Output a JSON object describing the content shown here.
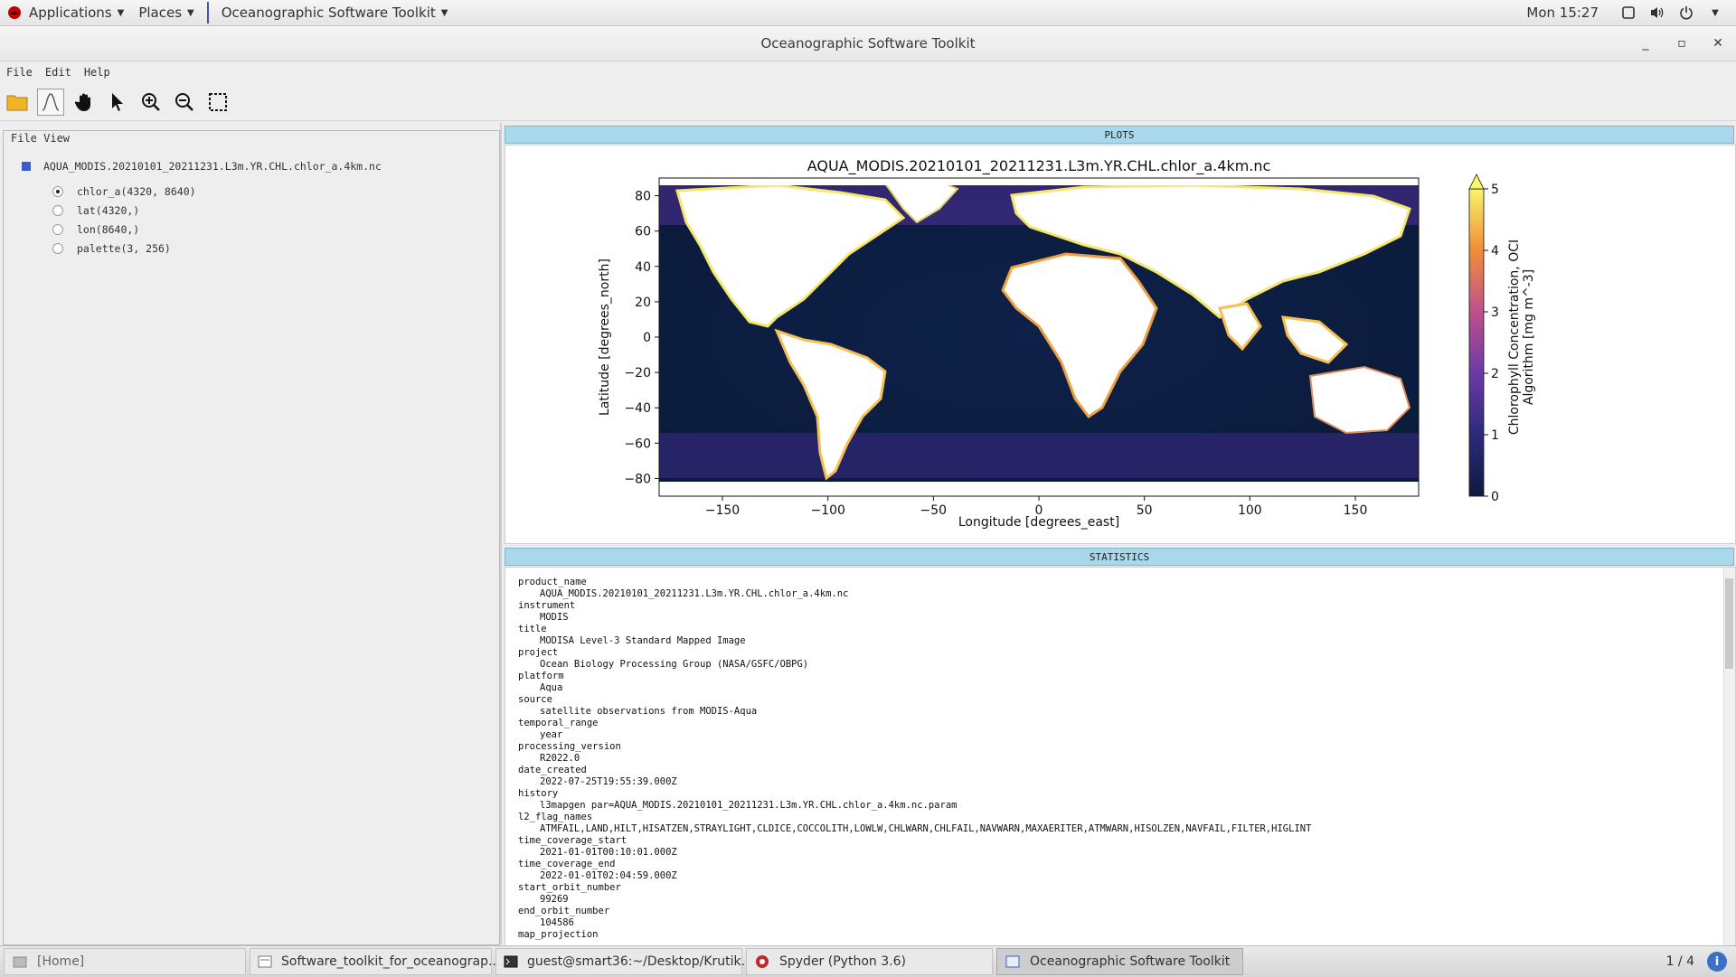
{
  "topbar": {
    "applications": "Applications",
    "places": "Places",
    "app_menu": "Oceanographic Software Toolkit",
    "clock": "Mon 15:27"
  },
  "window": {
    "title": "Oceanographic Software Toolkit"
  },
  "menubar": {
    "file": "File",
    "edit": "Edit",
    "help": "Help"
  },
  "toolbar": {
    "icons": [
      "open-folder-icon",
      "curve-icon",
      "pan-hand-icon",
      "pointer-icon",
      "zoom-in-icon",
      "zoom-out-icon",
      "select-box-icon"
    ]
  },
  "file_view": {
    "legend": "File View",
    "file_name": "AQUA_MODIS.20210101_20211231.L3m.YR.CHL.chlor_a.4km.nc",
    "variables": [
      {
        "label": "chlor_a(4320, 8640)",
        "selected": true
      },
      {
        "label": "lat(4320,)",
        "selected": false
      },
      {
        "label": "lon(8640,)",
        "selected": false
      },
      {
        "label": "palette(3, 256)",
        "selected": false
      }
    ]
  },
  "plots": {
    "header": "PLOTS",
    "title": "AQUA_MODIS.20210101_20211231.L3m.YR.CHL.chlor_a.4km.nc",
    "xlabel": "Longitude [degrees_east]",
    "ylabel": "Latitude [degrees_north]",
    "xticks": [
      "−150",
      "−100",
      "−50",
      "0",
      "50",
      "100",
      "150"
    ],
    "yticks": [
      "80",
      "60",
      "40",
      "20",
      "0",
      "−20",
      "−40",
      "−60",
      "−80"
    ],
    "colorbar_label_line1": "Chlorophyll Concentration, OCI",
    "colorbar_label_line2": "Algorithm [mg m^-3]",
    "colorbar_ticks": [
      "5",
      "4",
      "3",
      "2",
      "1",
      "0"
    ]
  },
  "chart_data": {
    "type": "heatmap",
    "title": "AQUA_MODIS.20210101_20211231.L3m.YR.CHL.chlor_a.4km.nc",
    "xlabel": "Longitude [degrees_east]",
    "ylabel": "Latitude [degrees_north]",
    "xlim": [
      -180,
      180
    ],
    "ylim": [
      -90,
      90
    ],
    "xticks": [
      -150,
      -100,
      -50,
      0,
      50,
      100,
      150
    ],
    "yticks": [
      80,
      60,
      40,
      20,
      0,
      -20,
      -40,
      -60,
      -80
    ],
    "colorbar": {
      "label": "Chlorophyll Concentration, OCI Algorithm [mg m^-3]",
      "range": [
        0,
        5
      ],
      "ticks": [
        0,
        1,
        2,
        3,
        4,
        5
      ],
      "extend": "max"
    },
    "colors": {
      "low": "#0d1b3e",
      "mid": "#7b3fa8",
      "high_orange": "#f28c38",
      "max": "#f7f56a",
      "land": "#ffffff"
    }
  },
  "statistics": {
    "header": "STATISTICS",
    "entries": [
      {
        "key": "product_name",
        "value": "AQUA_MODIS.20210101_20211231.L3m.YR.CHL.chlor_a.4km.nc"
      },
      {
        "key": "instrument",
        "value": "MODIS"
      },
      {
        "key": "title",
        "value": "MODISA Level-3 Standard Mapped Image"
      },
      {
        "key": "project",
        "value": "Ocean Biology Processing Group (NASA/GSFC/OBPG)"
      },
      {
        "key": "platform",
        "value": "Aqua"
      },
      {
        "key": "source",
        "value": "satellite observations from MODIS-Aqua"
      },
      {
        "key": "temporal_range",
        "value": "year"
      },
      {
        "key": "processing_version",
        "value": "R2022.0"
      },
      {
        "key": "date_created",
        "value": "2022-07-25T19:55:39.000Z"
      },
      {
        "key": "history",
        "value": "l3mapgen par=AQUA_MODIS.20210101_20211231.L3m.YR.CHL.chlor_a.4km.nc.param"
      },
      {
        "key": "l2_flag_names",
        "value": "ATMFAIL,LAND,HILT,HISATZEN,STRAYLIGHT,CLDICE,COCCOLITH,LOWLW,CHLWARN,CHLFAIL,NAVWARN,MAXAERITER,ATMWARN,HISOLZEN,NAVFAIL,FILTER,HIGLINT"
      },
      {
        "key": "time_coverage_start",
        "value": "2021-01-01T00:10:01.000Z"
      },
      {
        "key": "time_coverage_end",
        "value": "2022-01-01T02:04:59.000Z"
      },
      {
        "key": "start_orbit_number",
        "value": "99269"
      },
      {
        "key": "end_orbit_number",
        "value": "104586"
      },
      {
        "key": "map_projection",
        "value": ""
      }
    ]
  },
  "taskbar": {
    "tasks": [
      {
        "label": "[Home]",
        "icon": "folder-icon",
        "active": false
      },
      {
        "label": "Software_toolkit_for_oceanograp...",
        "icon": "document-icon",
        "active": false
      },
      {
        "label": "guest@smart36:~/Desktop/Krutik...",
        "icon": "terminal-icon",
        "active": false
      },
      {
        "label": "Spyder (Python 3.6)",
        "icon": "spyder-icon",
        "active": false
      },
      {
        "label": "Oceanographic Software Toolkit",
        "icon": "window-icon",
        "active": true
      }
    ],
    "pager": "1 / 4"
  }
}
